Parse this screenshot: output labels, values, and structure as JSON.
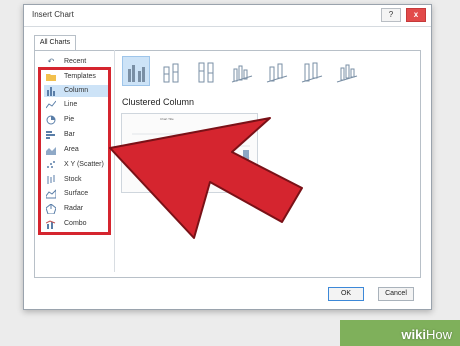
{
  "window": {
    "title": "Insert Chart",
    "help_label": "?",
    "close_label": "x"
  },
  "tab": {
    "label": "All Charts"
  },
  "sidebar": {
    "items": [
      {
        "label": "Recent",
        "icon": "undo-icon"
      },
      {
        "label": "Templates",
        "icon": "folder-icon"
      },
      {
        "label": "Column",
        "icon": "column-chart-icon",
        "selected": true
      },
      {
        "label": "Line",
        "icon": "line-chart-icon"
      },
      {
        "label": "Pie",
        "icon": "pie-chart-icon"
      },
      {
        "label": "Bar",
        "icon": "bar-chart-icon"
      },
      {
        "label": "Area",
        "icon": "area-chart-icon"
      },
      {
        "label": "X Y (Scatter)",
        "icon": "scatter-chart-icon"
      },
      {
        "label": "Stock",
        "icon": "stock-chart-icon"
      },
      {
        "label": "Surface",
        "icon": "surface-chart-icon"
      },
      {
        "label": "Radar",
        "icon": "radar-chart-icon"
      },
      {
        "label": "Combo",
        "icon": "combo-chart-icon"
      }
    ]
  },
  "chart_types": {
    "selected_title": "Clustered Column",
    "preview_title": "Chart Title",
    "icons": [
      "clustered-column-icon",
      "stacked-column-icon",
      "100-stacked-column-icon",
      "3d-clustered-column-icon",
      "3d-stacked-column-icon",
      "3d-100-stacked-column-icon",
      "3d-column-icon"
    ]
  },
  "footer": {
    "ok_label": "OK",
    "cancel_label": "Cancel"
  },
  "watermark": {
    "brand": "wiki",
    "brand2": "How"
  },
  "colors": {
    "highlight": "#cde3f7",
    "arrow": "#d5252f",
    "selection_border": "#d5252f"
  }
}
